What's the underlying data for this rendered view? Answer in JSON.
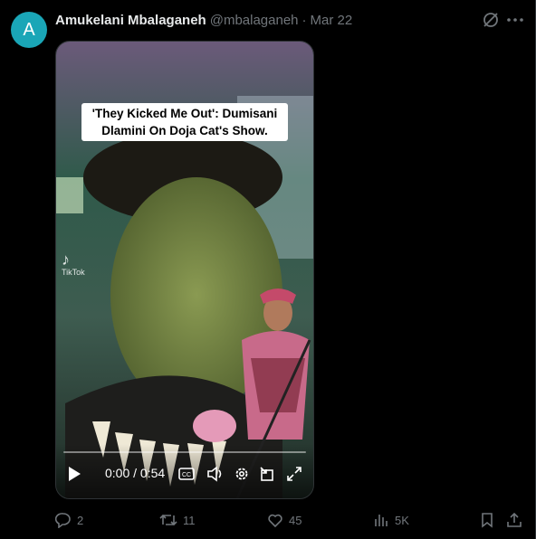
{
  "author": {
    "avatar_letter": "A",
    "display_name": "Amukelani Mbalaganeh",
    "handle": "@mbalaganeh",
    "separator": "·",
    "date": "Mar 22"
  },
  "media": {
    "caption": "'They Kicked Me Out': Dumisani Dlamini On Doja Cat's Show.",
    "watermark_logo": "♪",
    "watermark_text": "TikTok",
    "current_time": "0:00",
    "time_separator": "/",
    "duration": "0:54",
    "progress_fraction": 0
  },
  "actions": {
    "replies": "2",
    "reposts": "11",
    "likes": "45",
    "views": "5K"
  },
  "colors": {
    "avatar_bg": "#1aa6b7",
    "muted": "#71767b",
    "text": "#e7e9ea"
  }
}
